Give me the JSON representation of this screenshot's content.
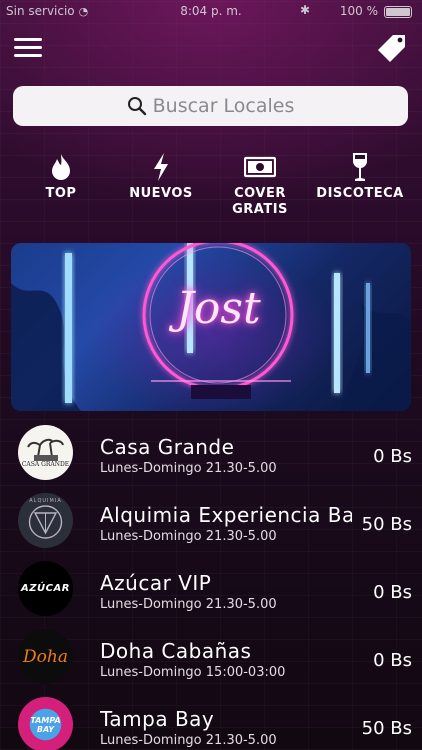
{
  "status_bar": {
    "carrier": "Sin servicio",
    "time": "8:04 p. m.",
    "battery": "100 %"
  },
  "icons": {
    "menu": "hamburger-menu-icon",
    "tag": "price-tag-icon",
    "search": "search-icon",
    "top": "flame-icon",
    "nuevos": "lightning-bolt-icon",
    "cover": "cash-bill-icon",
    "discoteca": "wine-glass-icon"
  },
  "search": {
    "placeholder": "Buscar Locales"
  },
  "categories": [
    {
      "label": "TOP"
    },
    {
      "label": "NUEVOS"
    },
    {
      "label": "COVER\nGRATIS"
    },
    {
      "label": "DISCOTECA"
    }
  ],
  "banner": {
    "text": "Jost"
  },
  "venues": [
    {
      "name": "Casa Grande",
      "hours": "Lunes-Domingo 21.30-5.00",
      "price": "0 Bs",
      "logo_text": "CASA GRANDE"
    },
    {
      "name": "Alquimia Experiencia Bar",
      "hours": "Lunes-Domingo 21.30-5.00",
      "price": "50 Bs",
      "logo_text": "ALQUIMIA"
    },
    {
      "name": "Azúcar VIP",
      "hours": "Lunes-Domingo 21.30-5.00",
      "price": "0 Bs",
      "logo_text": "AZÚCAR"
    },
    {
      "name": "Doha Cabañas",
      "hours": "Lunes-Domingo 15:00-03:00",
      "price": "0 Bs",
      "logo_text": "Doha"
    },
    {
      "name": "Tampa Bay",
      "hours": "Lunes-Domingo 21.30-5.00",
      "price": "50 Bs",
      "logo_text": "TAMPA BAY"
    }
  ],
  "colors": {
    "background_top": "#3a0f38",
    "background_bottom": "#120812",
    "search_bg": "#f4f2f4",
    "neon_pink": "#ff4fd8",
    "neon_blue": "#59b6ff"
  }
}
